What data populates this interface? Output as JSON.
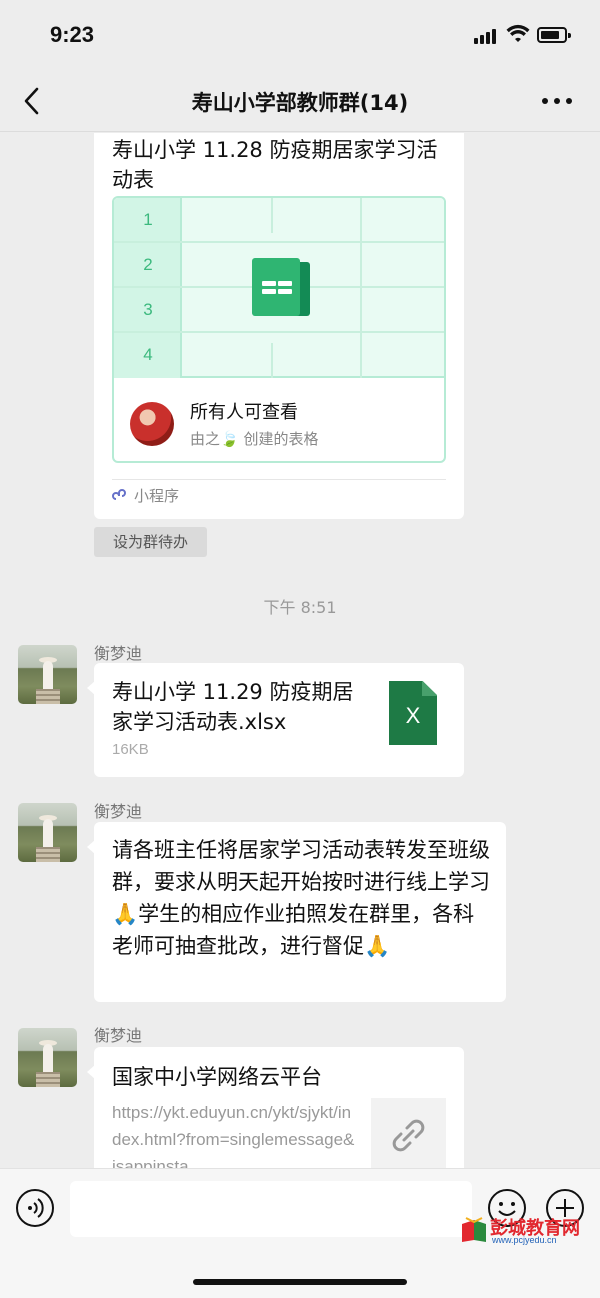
{
  "status_bar": {
    "time": "9:23"
  },
  "nav": {
    "title": "寿山小学部教师群(14)"
  },
  "messages": {
    "mini_program_card": {
      "title": "寿山小学 11.28 防疫期居家学习活动表",
      "row_numbers": [
        "1",
        "2",
        "3",
        "4"
      ],
      "visibility": "所有人可查看",
      "creator": "由之🍃 创建的表格",
      "source_label": "小程序"
    },
    "set_todo_label": "设为群待办",
    "timestamp": "下午 8:51",
    "file_message": {
      "sender": "衡梦迪",
      "filename": "寿山小学 11.29 防疫期居家学习活动表.xlsx",
      "size": "16KB",
      "file_icon_letter": "X"
    },
    "text_message": {
      "sender": "衡梦迪",
      "text": "请各班主任将居家学习活动表转发至班级群，要求从明天起开始按时进行线上学习🙏学生的相应作业拍照发在群里，各科老师可抽查批改，进行督促🙏"
    },
    "link_message": {
      "sender": "衡梦迪",
      "title": "国家中小学网络云平台",
      "url": "https://ykt.eduyun.cn/ykt/sjykt/index.html?from=singlemessage&isappinsta"
    }
  },
  "watermark": {
    "title": "彭城教育网",
    "url": "www.pcjyedu.cn"
  },
  "colors": {
    "bubble": "#ffffff",
    "chat_bg": "#ededed",
    "sheet_green": "#2fb572",
    "excel_green": "#1e7a45"
  },
  "icons": [
    "back-chevron-icon",
    "more-dots-icon",
    "spreadsheet-icon",
    "mini-program-icon",
    "excel-file-icon",
    "link-icon",
    "voice-icon",
    "emoji-icon",
    "plus-icon"
  ]
}
